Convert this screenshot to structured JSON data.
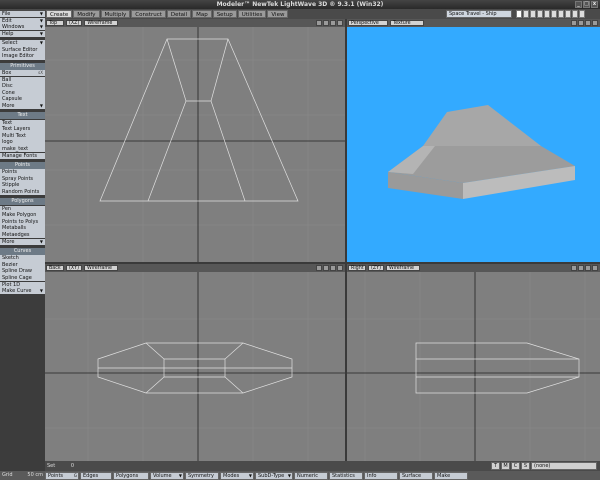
{
  "title": "Modeler™ NewTek LightWave 3D ® 9.3.1 (Win32)",
  "window_buttons": [
    "_",
    "□",
    "x"
  ],
  "tabs": [
    "Create",
    "Modify",
    "Multiply",
    "Construct",
    "Detail",
    "Map",
    "Setup",
    "Utilities",
    "View"
  ],
  "active_tab": "Create",
  "scene": "Space Travel - Ship",
  "sidebar": {
    "top": [
      {
        "label": "File",
        "arrow": true
      },
      {
        "label": "Edit",
        "arrow": true
      },
      {
        "label": "Windows",
        "arrow": true
      },
      {
        "label": "Help",
        "arrow": true
      }
    ],
    "top2": [
      {
        "label": "Select",
        "arrow": true
      },
      {
        "label": "Surface Editor"
      },
      {
        "label": "Image Editor"
      }
    ],
    "sections": [
      {
        "head": "Primitives",
        "items": [
          {
            "label": "Box",
            "key": "sX"
          },
          {
            "label": "Ball"
          },
          {
            "label": "Disc"
          },
          {
            "label": "Cone"
          },
          {
            "label": "Capsule"
          },
          {
            "label": "More",
            "arrow": true
          }
        ]
      },
      {
        "head": "Text",
        "items": [
          {
            "label": "Text"
          },
          {
            "label": "Text Layers"
          },
          {
            "label": "Multi Text"
          },
          {
            "label": "logo"
          },
          {
            "label": "make_text"
          },
          {
            "label": "Manage Fonts"
          }
        ]
      },
      {
        "head": "Points",
        "items": [
          {
            "label": "Points"
          },
          {
            "label": "Spray Points"
          },
          {
            "label": "Stipple"
          },
          {
            "label": "Random Points"
          }
        ]
      },
      {
        "head": "Polygons",
        "items": [
          {
            "label": "Pen"
          },
          {
            "label": "Make Polygon"
          },
          {
            "label": "Points to Polys"
          },
          {
            "label": "Metaballs"
          },
          {
            "label": "Metaedges"
          },
          {
            "label": "More",
            "arrow": true
          }
        ]
      },
      {
        "head": "Curves",
        "items": [
          {
            "label": "Sketch"
          },
          {
            "label": "Bezier"
          },
          {
            "label": "Spline Draw"
          },
          {
            "label": "Spline Cage"
          },
          {
            "label": "Plot 1D"
          },
          {
            "label": "Make Curve",
            "arrow": true
          }
        ]
      }
    ]
  },
  "viewports": {
    "top": {
      "view": "Top",
      "axis": "(XZ)",
      "mode": "Wireframe"
    },
    "perspective": {
      "view": "Perspective",
      "mode": "Texture"
    },
    "back": {
      "view": "Back",
      "axis": "(XY)",
      "mode": "Wireframe"
    },
    "right": {
      "view": "Right",
      "axis": "(ZY)",
      "mode": "Wireframe"
    }
  },
  "status": {
    "set_label": "Set",
    "set_value": "0",
    "layer_buttons": [
      "T",
      "M",
      "C",
      "S"
    ],
    "surface_select": "(none)"
  },
  "modebar": {
    "grid_label": "Grid",
    "grid_value": "50 cm",
    "buttons": [
      {
        "label": "Points",
        "key": "G"
      },
      {
        "label": "Edges"
      },
      {
        "label": "Polygons"
      },
      {
        "label": "Volume",
        "arrow": true
      },
      {
        "label": "Symmetry"
      },
      {
        "label": "Modes",
        "arrow": true
      },
      {
        "label": "SubD-Type",
        "arrow": true
      },
      {
        "label": "Numeric"
      },
      {
        "label": "Statistics"
      },
      {
        "label": "Info"
      },
      {
        "label": "Surface"
      },
      {
        "label": "Make"
      }
    ]
  },
  "colors": {
    "perspective_bg": "#33aaff",
    "grid_bg": "#7f7f7f",
    "wire": "#e0e0e0"
  }
}
